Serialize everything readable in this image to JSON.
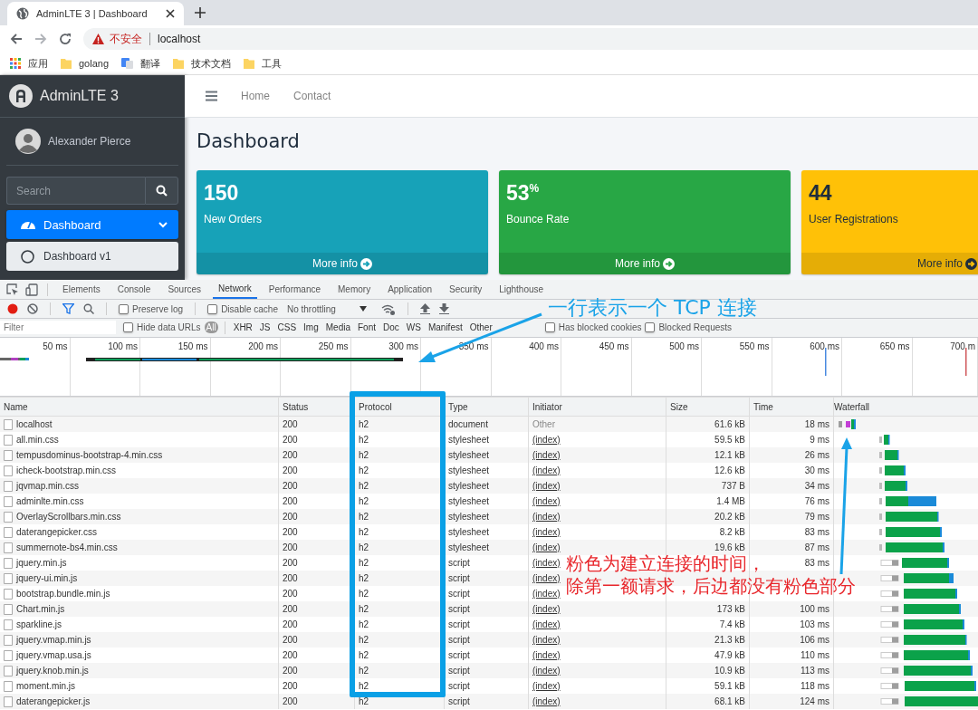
{
  "browser": {
    "tab": {
      "title": "AdminLTE 3 | Dashboard"
    },
    "address": {
      "warning": "不安全",
      "url": "localhost"
    },
    "bookmarks": [
      {
        "kind": "apps",
        "label": "应用"
      },
      {
        "kind": "folder",
        "label": "golang"
      },
      {
        "kind": "translate",
        "label": "翻译"
      },
      {
        "kind": "folder",
        "label": "技术文档"
      },
      {
        "kind": "folder",
        "label": "工具"
      }
    ]
  },
  "sidebar": {
    "brand": "AdminLTE 3",
    "user": "Alexander Pierce",
    "search": {
      "placeholder": "Search"
    },
    "nav": [
      {
        "label": "Dashboard",
        "selected": true,
        "expanded": true,
        "children": [
          {
            "label": "Dashboard v1",
            "selected": true
          }
        ]
      }
    ]
  },
  "navbar": {
    "links": [
      "Home",
      "Contact"
    ]
  },
  "content": {
    "title": "Dashboard",
    "boxes": [
      {
        "value": "150",
        "label": "New Orders",
        "link": "More info",
        "color": "#17a2b8"
      },
      {
        "value": "53$^{%}$",
        "label": "Bounce Rate",
        "link": "More info",
        "color": "#28a745"
      },
      {
        "value": "44",
        "label": "User Registrations",
        "link": "More info",
        "color": "#ffc107"
      }
    ]
  },
  "devtools": {
    "tabs": [
      {
        "label": "Elements",
        "selected": false
      },
      {
        "label": "Console",
        "selected": false
      },
      {
        "label": "Sources",
        "selected": false
      },
      {
        "label": "Network",
        "selected": true
      },
      {
        "label": "Performance",
        "selected": false
      },
      {
        "label": "Memory",
        "selected": false
      },
      {
        "label": "Application",
        "selected": false
      },
      {
        "label": "Security",
        "selected": false
      },
      {
        "label": "Lighthouse",
        "selected": false
      }
    ],
    "toolbar": {
      "recording": true,
      "filter_active": true,
      "preserve_log": {
        "label": "Preserve log",
        "checked": false
      },
      "disable_cache": {
        "label": "Disable cache",
        "checked": false
      },
      "throttling": "No throttling"
    },
    "filter_bar": {
      "placeholder": "Filter",
      "hide_data_urls": {
        "label": "Hide data URLs",
        "checked": false
      },
      "types": [
        {
          "label": "All",
          "selected": true
        },
        {
          "label": "XHR",
          "selected": false
        },
        {
          "label": "JS",
          "selected": false
        },
        {
          "label": "CSS",
          "selected": false
        },
        {
          "label": "Img",
          "selected": false
        },
        {
          "label": "Media",
          "selected": false
        },
        {
          "label": "Font",
          "selected": false
        },
        {
          "label": "Doc",
          "selected": false
        },
        {
          "label": "WS",
          "selected": false
        },
        {
          "label": "Manifest",
          "selected": false
        },
        {
          "label": "Other",
          "selected": false
        }
      ],
      "blocked_cookies": {
        "label": "Has blocked cookies",
        "checked": false
      },
      "blocked_requests": {
        "label": "Blocked Requests",
        "checked": false
      }
    },
    "overview": {
      "ticks": [
        "50 ms",
        "100 ms",
        "150 ms",
        "200 ms",
        "250 ms",
        "300 ms",
        "350 ms",
        "400 ms",
        "450 ms",
        "500 ms",
        "550 ms",
        "600 ms",
        "650 ms",
        "700 m"
      ]
    },
    "table": {
      "columns": [
        "Name",
        "Status",
        "Protocol",
        "Type",
        "Initiator",
        "Size",
        "Time",
        "Waterfall"
      ],
      "rows": [
        {
          "name": "localhost",
          "status": "200",
          "protocol": "h2",
          "type": "document",
          "initiator": {
            "text": "Other",
            "link": false
          },
          "size": "61.6 kB",
          "time": "18 ms"
        },
        {
          "name": "all.min.css",
          "status": "200",
          "protocol": "h2",
          "type": "stylesheet",
          "initiator": {
            "text": "(index)",
            "link": true
          },
          "size": "59.5 kB",
          "time": "9 ms"
        },
        {
          "name": "tempusdominus-bootstrap-4.min.css",
          "status": "200",
          "protocol": "h2",
          "type": "stylesheet",
          "initiator": {
            "text": "(index)",
            "link": true
          },
          "size": "12.1 kB",
          "time": "26 ms"
        },
        {
          "name": "icheck-bootstrap.min.css",
          "status": "200",
          "protocol": "h2",
          "type": "stylesheet",
          "initiator": {
            "text": "(index)",
            "link": true
          },
          "size": "12.6 kB",
          "time": "30 ms"
        },
        {
          "name": "jqvmap.min.css",
          "status": "200",
          "protocol": "h2",
          "type": "stylesheet",
          "initiator": {
            "text": "(index)",
            "link": true
          },
          "size": "737 B",
          "time": "34 ms"
        },
        {
          "name": "adminlte.min.css",
          "status": "200",
          "protocol": "h2",
          "type": "stylesheet",
          "initiator": {
            "text": "(index)",
            "link": true
          },
          "size": "1.4 MB",
          "time": "76 ms"
        },
        {
          "name": "OverlayScrollbars.min.css",
          "status": "200",
          "protocol": "h2",
          "type": "stylesheet",
          "initiator": {
            "text": "(index)",
            "link": true
          },
          "size": "20.2 kB",
          "time": "79 ms"
        },
        {
          "name": "daterangepicker.css",
          "status": "200",
          "protocol": "h2",
          "type": "stylesheet",
          "initiator": {
            "text": "(index)",
            "link": true
          },
          "size": "8.2 kB",
          "time": "83 ms"
        },
        {
          "name": "summernote-bs4.min.css",
          "status": "200",
          "protocol": "h2",
          "type": "stylesheet",
          "initiator": {
            "text": "(index)",
            "link": true
          },
          "size": "19.6 kB",
          "time": "87 ms"
        },
        {
          "name": "jquery.min.js",
          "status": "200",
          "protocol": "h2",
          "type": "script",
          "initiator": {
            "text": "(index)",
            "link": true
          },
          "time": "83 ms"
        },
        {
          "name": "jquery-ui.min.js",
          "status": "200",
          "protocol": "h2",
          "type": "script",
          "initiator": {
            "text": "(index)",
            "link": true
          }
        },
        {
          "name": "bootstrap.bundle.min.js",
          "status": "200",
          "protocol": "h2",
          "type": "script",
          "initiator": {
            "text": "(index)",
            "link": true
          }
        },
        {
          "name": "Chart.min.js",
          "status": "200",
          "protocol": "h2",
          "type": "script",
          "initiator": {
            "text": "(index)",
            "link": true
          },
          "size": "173 kB",
          "time": "100 ms"
        },
        {
          "name": "sparkline.js",
          "status": "200",
          "protocol": "h2",
          "type": "script",
          "initiator": {
            "text": "(index)",
            "link": true
          },
          "size": "7.4 kB",
          "time": "103 ms"
        },
        {
          "name": "jquery.vmap.min.js",
          "status": "200",
          "protocol": "h2",
          "type": "script",
          "initiator": {
            "text": "(index)",
            "link": true
          },
          "size": "21.3 kB",
          "time": "106 ms"
        },
        {
          "name": "jquery.vmap.usa.js",
          "status": "200",
          "protocol": "h2",
          "type": "script",
          "initiator": {
            "text": "(index)",
            "link": true
          },
          "size": "47.9 kB",
          "time": "110 ms"
        },
        {
          "name": "jquery.knob.min.js",
          "status": "200",
          "protocol": "h2",
          "type": "script",
          "initiator": {
            "text": "(index)",
            "link": true
          },
          "size": "10.9 kB",
          "time": "113 ms"
        },
        {
          "name": "moment.min.js",
          "status": "200",
          "protocol": "h2",
          "type": "script",
          "initiator": {
            "text": "(index)",
            "link": true
          },
          "size": "59.1 kB",
          "time": "118 ms"
        },
        {
          "name": "daterangepicker.js",
          "status": "200",
          "protocol": "h2",
          "type": "script",
          "initiator": {
            "text": "(index)",
            "link": true
          },
          "size": "68.1 kB",
          "time": "124 ms"
        }
      ]
    }
  },
  "annotations": [
    {
      "kind": "callout",
      "lines": [
        "一行表示一个 TCP 连接"
      ],
      "color": "#1aa3e8"
    },
    {
      "kind": "callout",
      "lines": [
        "粉色为建立连接的时间，",
        "除第一额请求，后边都没有粉色部分"
      ],
      "color": "#e8262b"
    }
  ]
}
